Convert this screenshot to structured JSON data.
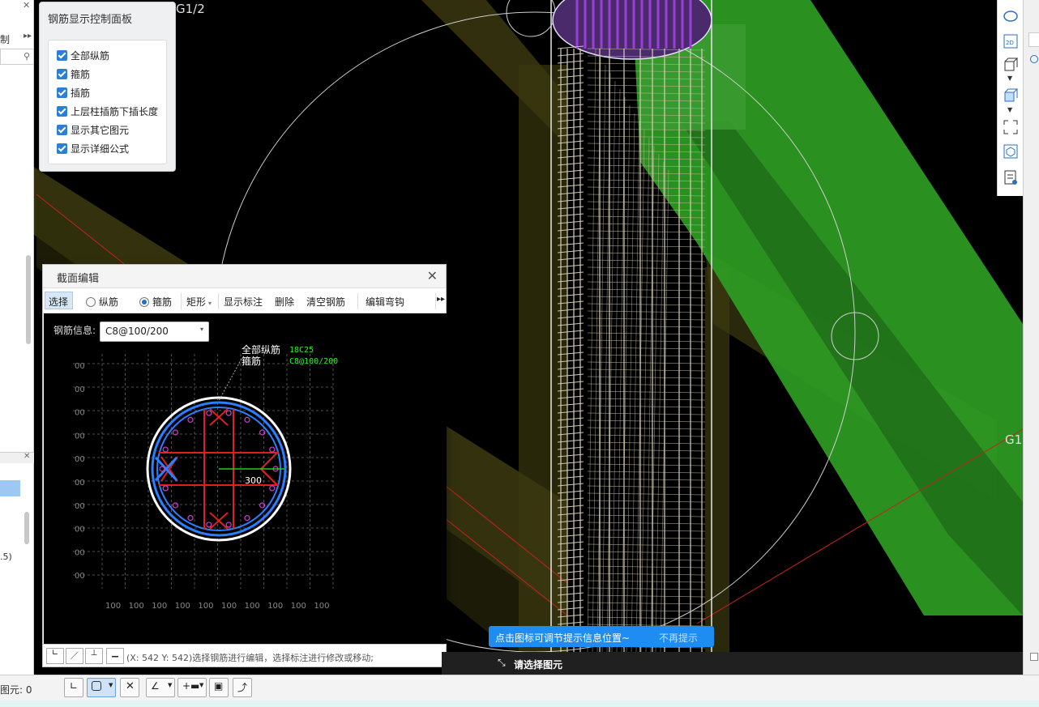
{
  "scene": {
    "grid_label_top": "G1/2",
    "grid_label_right": "G1"
  },
  "left_panel": {
    "label_1": "制",
    "label_2": ".5)",
    "element_count_label": "图元:",
    "element_count": "0"
  },
  "control_panel": {
    "title": "钢筋显示控制面板",
    "options": [
      {
        "label": "全部纵筋",
        "checked": true
      },
      {
        "label": "箍筋",
        "checked": true
      },
      {
        "label": "插筋",
        "checked": true
      },
      {
        "label": "上层柱插筋下插长度",
        "checked": true
      },
      {
        "label": "显示其它图元",
        "checked": true
      },
      {
        "label": "显示详细公式",
        "checked": true
      }
    ]
  },
  "section_editor": {
    "title": "截面编辑",
    "toolbar": {
      "select": "选择",
      "longitudinal": "纵筋",
      "stirrup": "箍筋",
      "shape": "矩形",
      "show_annotation": "显示标注",
      "delete": "删除",
      "clear_rebar": "清空钢筋",
      "edit_hook": "编辑弯钩"
    },
    "rebar_info_label": "钢筋信息:",
    "rebar_info_value": "C8@100/200",
    "legend": {
      "longitudinal_label": "全部纵筋",
      "longitudinal_value": "18C25",
      "stirrup_label": "箍筋",
      "stirrup_value": "C8@100/200"
    },
    "dimension": "300",
    "ruler_left": "00",
    "ruler_bottom": "100",
    "status": "(X: 542 Y: 542)选择钢筋进行编辑，选择标注进行修改或移动;"
  },
  "tip": {
    "text": "点击图标可调节提示信息位置~",
    "dismiss": "不再提示"
  },
  "prompt": "请选择图元",
  "colors": {
    "accent": "#1e8cf0",
    "rebar_red": "#e02020",
    "stirrup_blue": "#2a7fff",
    "green_beam": "#2fa024"
  }
}
